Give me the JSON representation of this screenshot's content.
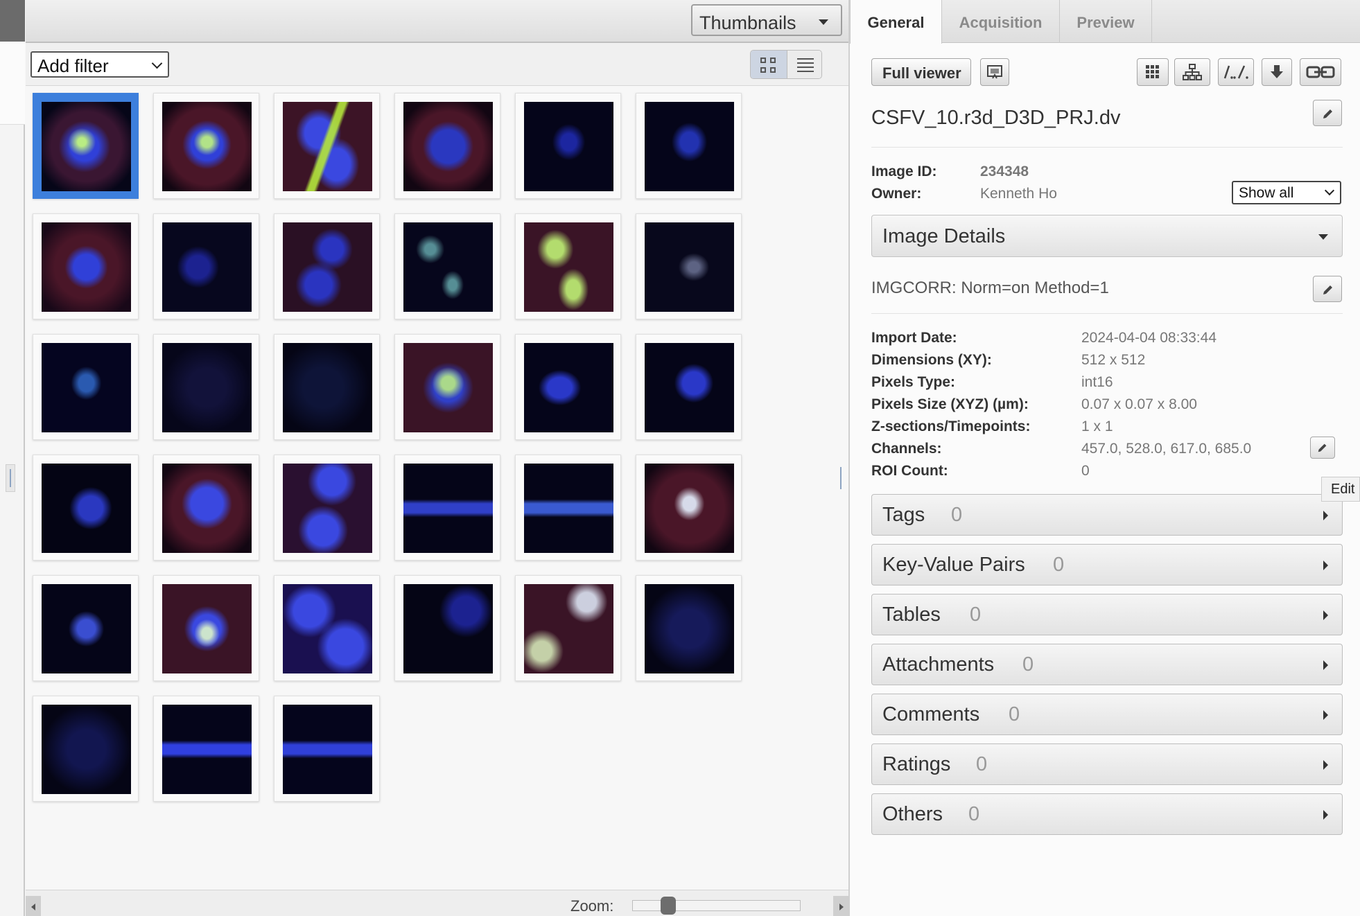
{
  "center": {
    "view_select": "Thumbnails",
    "filter_select": "Add filter",
    "thumbnail_count": 33,
    "selected_index": 0,
    "zoom_label": "Zoom:",
    "zoom_level": 0.18
  },
  "right_panel": {
    "tabs": [
      "General",
      "Acquisition",
      "Preview"
    ],
    "active_tab": "General",
    "full_viewer_label": "Full viewer",
    "toolbar_icons": [
      "open-with-icon",
      "grid-icon",
      "hierarchy-icon",
      "path-icon",
      "download-icon",
      "link-icon"
    ],
    "image_name": "CSFV_10.r3d_D3D_PRJ.dv",
    "image_id_label": "Image ID:",
    "image_id": "234348",
    "owner_label": "Owner:",
    "owner": "Kenneth Ho",
    "show_select": "Show all",
    "image_details_label": "Image Details",
    "description": "IMGCORR: Norm=on Method=1",
    "details": [
      {
        "label": "Import Date:",
        "value": "2024-04-04 08:33:44"
      },
      {
        "label": "Dimensions (XY):",
        "value": "512 x 512"
      },
      {
        "label": "Pixels Type:",
        "value": "int16"
      },
      {
        "label": "Pixels Size (XYZ) (µm):",
        "value": "0.07 x 0.07 x 8.00"
      },
      {
        "label": "Z-sections/Timepoints:",
        "value": "1 x 1"
      },
      {
        "label": "Channels:",
        "value": "457.0, 528.0, 617.0, 685.0"
      },
      {
        "label": "ROI Count:",
        "value": "0"
      }
    ],
    "tooltip": "Edit",
    "sections": [
      {
        "title": "Tags",
        "count": "0"
      },
      {
        "title": "Key-Value Pairs",
        "count": "0"
      },
      {
        "title": "Tables",
        "count": "0"
      },
      {
        "title": "Attachments",
        "count": "0"
      },
      {
        "title": "Comments",
        "count": "0"
      },
      {
        "title": "Ratings",
        "count": "0"
      },
      {
        "title": "Others",
        "count": "0"
      }
    ]
  },
  "colors": {
    "selection": "#3d7fdc",
    "thumb_background": "#050515",
    "nucleus_blue": "#2a36c8",
    "cytoplasm_red": "#4a1628",
    "spot_green": "#c8ff7a"
  }
}
